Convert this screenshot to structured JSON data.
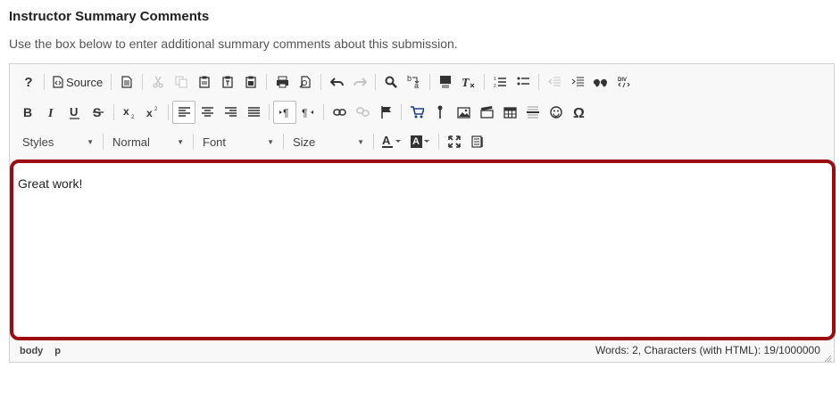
{
  "header": {
    "title": "Instructor Summary Comments",
    "instructions": "Use the box below to enter additional summary comments about this submission."
  },
  "toolbar": {
    "source_label": "Source",
    "styles_label": "Styles",
    "format_label": "Normal",
    "font_label": "Font",
    "size_label": "Size"
  },
  "editor": {
    "content": "Great work!"
  },
  "status_bar": {
    "path": [
      "body",
      "p"
    ],
    "word_count": "Words: 2, Characters (with HTML): 19/1000000"
  },
  "colors": {
    "focus_border": "#9b0b10",
    "toolbar_bg": "#f8f8f8"
  }
}
